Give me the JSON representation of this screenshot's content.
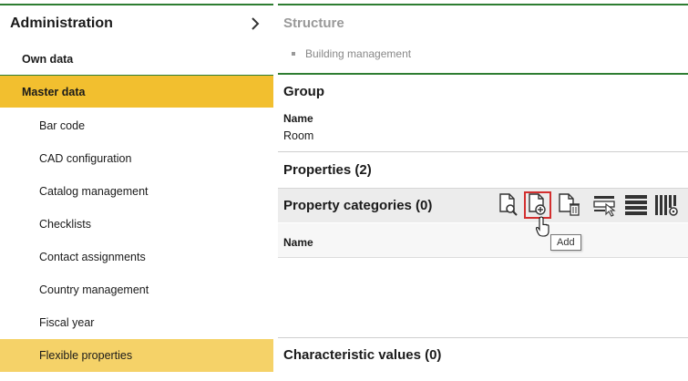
{
  "sidebar": {
    "title": "Administration",
    "items": [
      {
        "label": "Own data"
      },
      {
        "label": "Master data"
      },
      {
        "label": "Bar code"
      },
      {
        "label": "CAD configuration"
      },
      {
        "label": "Catalog management"
      },
      {
        "label": "Checklists"
      },
      {
        "label": "Contact assignments"
      },
      {
        "label": "Country management"
      },
      {
        "label": "Fiscal year"
      },
      {
        "label": "Flexible properties"
      }
    ]
  },
  "main": {
    "structure": {
      "title": "Structure",
      "breadcrumb_item": "Building management"
    },
    "group": {
      "title": "Group",
      "name_label": "Name",
      "name_value": "Room"
    },
    "properties": {
      "title": "Properties (2)"
    },
    "property_categories": {
      "title": "Property categories (0)",
      "column_name": "Name",
      "tooltip": "Add"
    },
    "characteristic_values": {
      "title": "Characteristic values (0)"
    }
  },
  "colors": {
    "accent_green": "#2e7d32",
    "active_item": "#f2bf2f",
    "selected_item": "#f5d268",
    "highlight_red": "#d32f2f"
  }
}
